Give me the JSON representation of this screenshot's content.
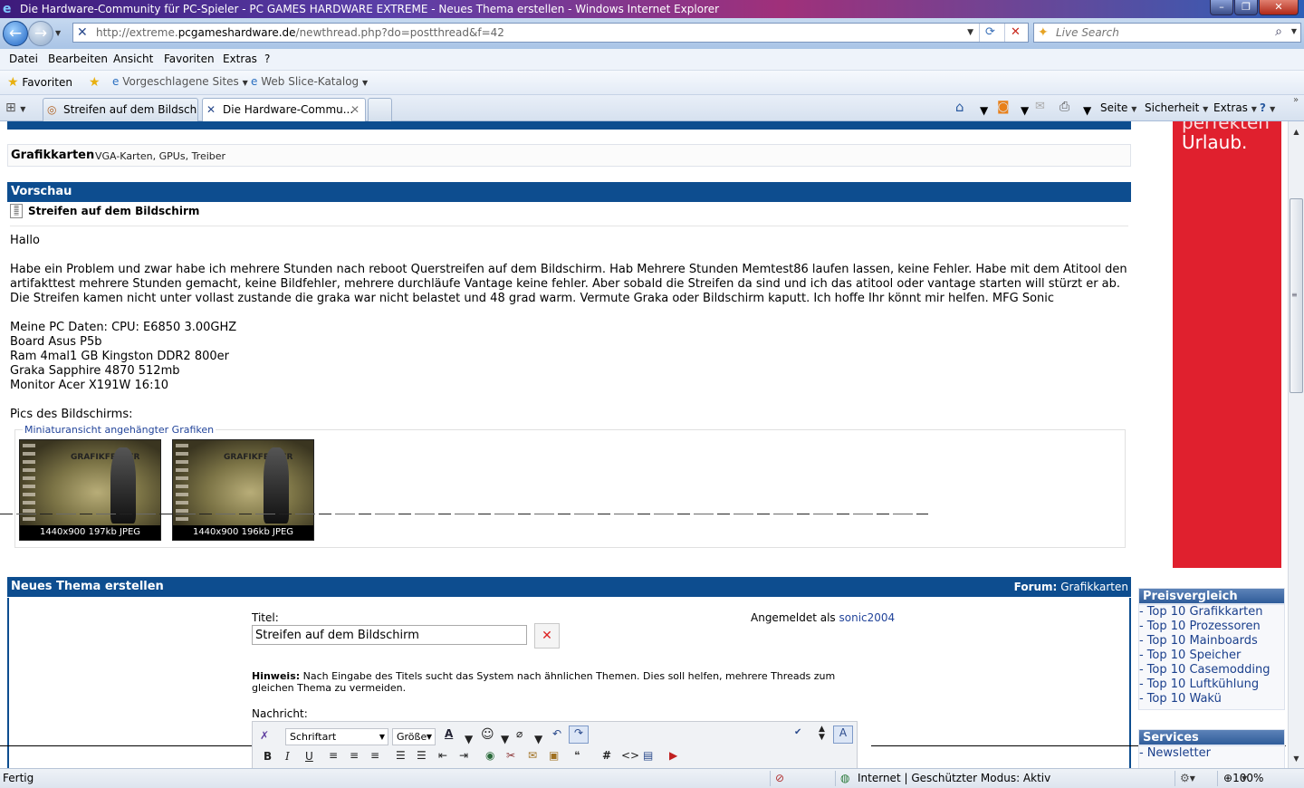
{
  "window": {
    "title": "Die Hardware-Community für PC-Spieler - PC GAMES HARDWARE EXTREME - Neues Thema erstellen - Windows Internet Explorer"
  },
  "address_bar": {
    "url_prefix": "http://extreme.",
    "url_domain": "pcgameshardware.de",
    "url_path": "/newthread.php?do=postthread&f=42",
    "search_placeholder": "Live Search"
  },
  "menu": [
    "Datei",
    "Bearbeiten",
    "Ansicht",
    "Favoriten",
    "Extras",
    "?"
  ],
  "favorites_bar": {
    "favorites": "Favoriten",
    "suggested_sites": "Vorgeschlagene Sites",
    "web_slice": "Web Slice-Katalog"
  },
  "tabs": [
    {
      "label": "Streifen auf dem Bildschir...",
      "active": false
    },
    {
      "label": "Die Hardware-Commu...",
      "active": true
    }
  ],
  "command_bar": {
    "page": "Seite",
    "security": "Sicherheit",
    "extras": "Extras"
  },
  "forum": {
    "category_title": "Grafikkarten",
    "category_desc": "VGA-Karten, GPUs, Treiber",
    "preview_header": "Vorschau",
    "thread_title": "Streifen auf dem Bildschirm",
    "post": {
      "greeting": "Hallo",
      "body": "Habe ein Problem und zwar habe ich mehrere Stunden nach reboot Querstreifen auf dem Bildschirm. Hab Mehrere Stunden Memtest86 laufen lassen, keine Fehler. Habe mit dem Atitool den artifakttest mehrere Stunden gemacht, keine Bildfehler, mehrere durchläufe Vantage keine fehler. Aber sobald die Streifen da sind und ich das atitool oder vantage starten will stürzt er ab. Die Streifen kamen nicht unter vollast zustande die graka war nicht belastet und 48 grad warm. Vermute Graka oder Bildschirm kaputt. Ich hoffe Ihr könnt mir helfen. MFG Sonic",
      "specs": [
        "Meine PC Daten: CPU: E6850 3.00GHZ",
        "Board Asus P5b",
        "Ram 4mal1 GB Kingston DDR2 800er",
        "Graka Sapphire 4870 512mb",
        "Monitor Acer X191W 16:10"
      ],
      "pics_label": "Pics des Bildschirms:"
    },
    "attachments": {
      "legend": "Miniaturansicht angehängter Grafiken",
      "items": [
        {
          "caption": "1440x900 197kb  JPEG",
          "logo": "GRAFIKFEHLER"
        },
        {
          "caption": "1440x900 196kb  JPEG",
          "logo": "GRAFIKFEHLER"
        }
      ]
    },
    "new_thread": {
      "header": "Neues Thema erstellen",
      "forum_label": "Forum:",
      "forum_name": "Grafikkarten",
      "title_label": "Titel:",
      "title_value": "Streifen auf dem Bildschirm",
      "logged_in_label": "Angemeldet als",
      "username": "sonic2004",
      "hint_label": "Hinweis:",
      "hint_text": "Nach Eingabe des Titels sucht das System nach ähnlichen Themen. Dies soll helfen, mehrere Threads zum gleichen Thema zu vermeiden.",
      "message_label": "Nachricht:",
      "font_select": "Schriftart",
      "size_select": "Größe"
    }
  },
  "sidebar": {
    "ad_text_1": "perfekten",
    "ad_text_2": "Urlaub.",
    "price_compare": {
      "title": "Preisvergleich",
      "items": [
        "Top 10 Grafikkarten",
        "Top 10 Prozessoren",
        "Top 10 Mainboards",
        "Top 10 Speicher",
        "Top 10 Casemodding",
        "Top 10 Luftkühlung",
        "Top 10 Wakü"
      ]
    },
    "services": {
      "title": "Services",
      "items": [
        "Newsletter"
      ]
    }
  },
  "status_bar": {
    "status": "Fertig",
    "zone": "Internet | Geschützter Modus: Aktiv",
    "zoom": "100%"
  },
  "colors": {
    "forum_header_blue": "#0d4d8f",
    "ad_red": "#e0202e",
    "link_blue": "#22449a"
  }
}
